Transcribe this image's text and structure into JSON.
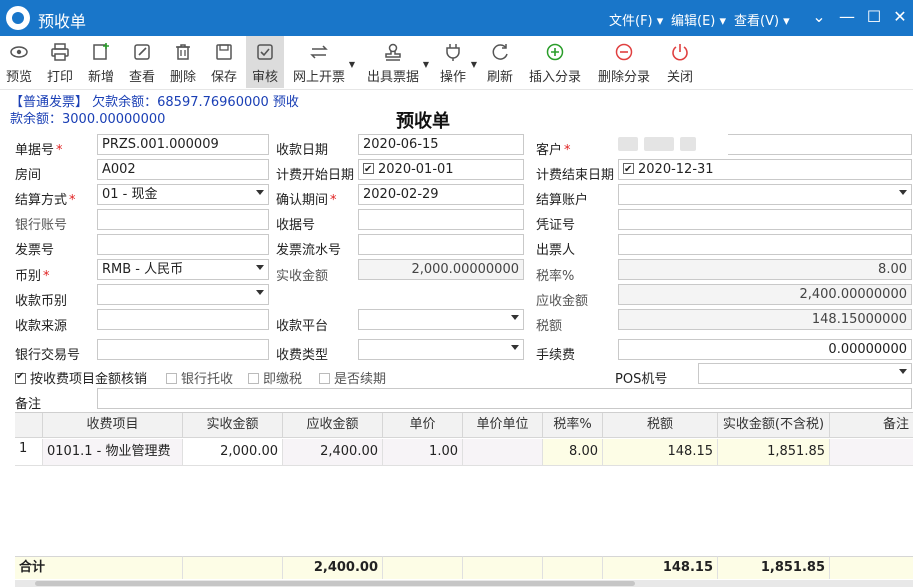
{
  "window": {
    "title": "预收单",
    "menus": [
      "文件(F)",
      "编辑(E)",
      "查看(V)"
    ]
  },
  "toolbar": [
    {
      "label": "预览",
      "icon": "eye-icon"
    },
    {
      "label": "打印",
      "icon": "printer-icon"
    },
    {
      "label": "新增",
      "icon": "add-doc-icon"
    },
    {
      "label": "查看",
      "icon": "edit-view-icon"
    },
    {
      "label": "删除",
      "icon": "trash-icon"
    },
    {
      "label": "保存",
      "icon": "save-icon"
    },
    {
      "label": "审核",
      "icon": "check-icon"
    },
    {
      "label": "网上开票",
      "icon": "swap-arrows-icon"
    },
    {
      "label": "出具票据",
      "icon": "stamp-icon"
    },
    {
      "label": "操作",
      "icon": "plug-icon"
    },
    {
      "label": "刷新",
      "icon": "refresh-icon"
    },
    {
      "label": "插入分录",
      "icon": "plus-circle-icon"
    },
    {
      "label": "删除分录",
      "icon": "minus-circle-icon"
    },
    {
      "label": "关闭",
      "icon": "power-icon"
    }
  ],
  "info": {
    "line1": "【普通发票】 欠款余额：68597.76960000 预收",
    "line2": "款余额：3000.00000000"
  },
  "form_title": "预收单",
  "fields": {
    "bill_no": {
      "label": "单据号",
      "value": "PRZS.001.000009"
    },
    "receipt_date": {
      "label": "收款日期",
      "value": "2020-06-15"
    },
    "customer": {
      "label": "客户"
    },
    "room": {
      "label": "房间",
      "value": "A002"
    },
    "fee_start": {
      "label": "计费开始日期",
      "value": "2020-01-01"
    },
    "fee_end": {
      "label": "计费结束日期",
      "value": "2020-12-31"
    },
    "settle_method": {
      "label": "结算方式",
      "value": "01 - 现金"
    },
    "confirm_period": {
      "label": "确认期间",
      "value": "2020-02-29"
    },
    "settle_account": {
      "label": "结算账户",
      "value": ""
    },
    "bank_account": {
      "label": "银行账号",
      "value": ""
    },
    "receipt_no": {
      "label": "收据号",
      "value": ""
    },
    "voucher_no": {
      "label": "凭证号",
      "value": ""
    },
    "invoice_no": {
      "label": "发票号",
      "value": ""
    },
    "invoice_serial": {
      "label": "发票流水号",
      "value": ""
    },
    "issuer": {
      "label": "出票人",
      "value": ""
    },
    "currency": {
      "label": "币别",
      "value": "RMB - 人民币"
    },
    "actual_amount": {
      "label": "实收金额",
      "value": "2,000.00000000"
    },
    "tax_rate": {
      "label": "税率%",
      "value": "8.00"
    },
    "receipt_currency": {
      "label": "收款币别",
      "value": ""
    },
    "receivable": {
      "label": "应收金额",
      "value": "2,400.00000000"
    },
    "receipt_source": {
      "label": "收款来源",
      "value": ""
    },
    "receipt_platform": {
      "label": "收款平台",
      "value": ""
    },
    "tax_amount": {
      "label": "税额",
      "value": "148.15000000"
    },
    "bank_txn_no": {
      "label": "银行交易号",
      "value": ""
    },
    "receipt_type": {
      "label": "收费类型",
      "value": ""
    },
    "handling_fee": {
      "label": "手续费",
      "value": "0.00000000"
    },
    "pos_no": {
      "label": "POS机号",
      "value": ""
    },
    "remark": {
      "label": "备注",
      "value": ""
    }
  },
  "options": {
    "by_item": {
      "label": "按收费项目金额核销",
      "checked": true
    },
    "bank_entrust": {
      "label": "银行托收",
      "checked": false
    },
    "instant_tax": {
      "label": "即缴税",
      "checked": false
    },
    "renewal": {
      "label": "是否续期",
      "checked": false
    }
  },
  "table": {
    "headers": [
      "收费项目",
      "实收金额",
      "应收金额",
      "单价",
      "单价单位",
      "税率%",
      "税额",
      "实收金额(不含税)",
      "备注"
    ],
    "rows": [
      {
        "idx": "1",
        "item": "0101.1 - 物业管理费",
        "actual": "2,000.00",
        "receivable": "2,400.00",
        "price": "1.00",
        "unit": "",
        "rate": "8.00",
        "tax": "148.15",
        "net": "1,851.85",
        "remark": ""
      }
    ],
    "totals": {
      "label": "合计",
      "receivable": "2,400.00",
      "tax": "148.15",
      "net": "1,851.85"
    }
  }
}
